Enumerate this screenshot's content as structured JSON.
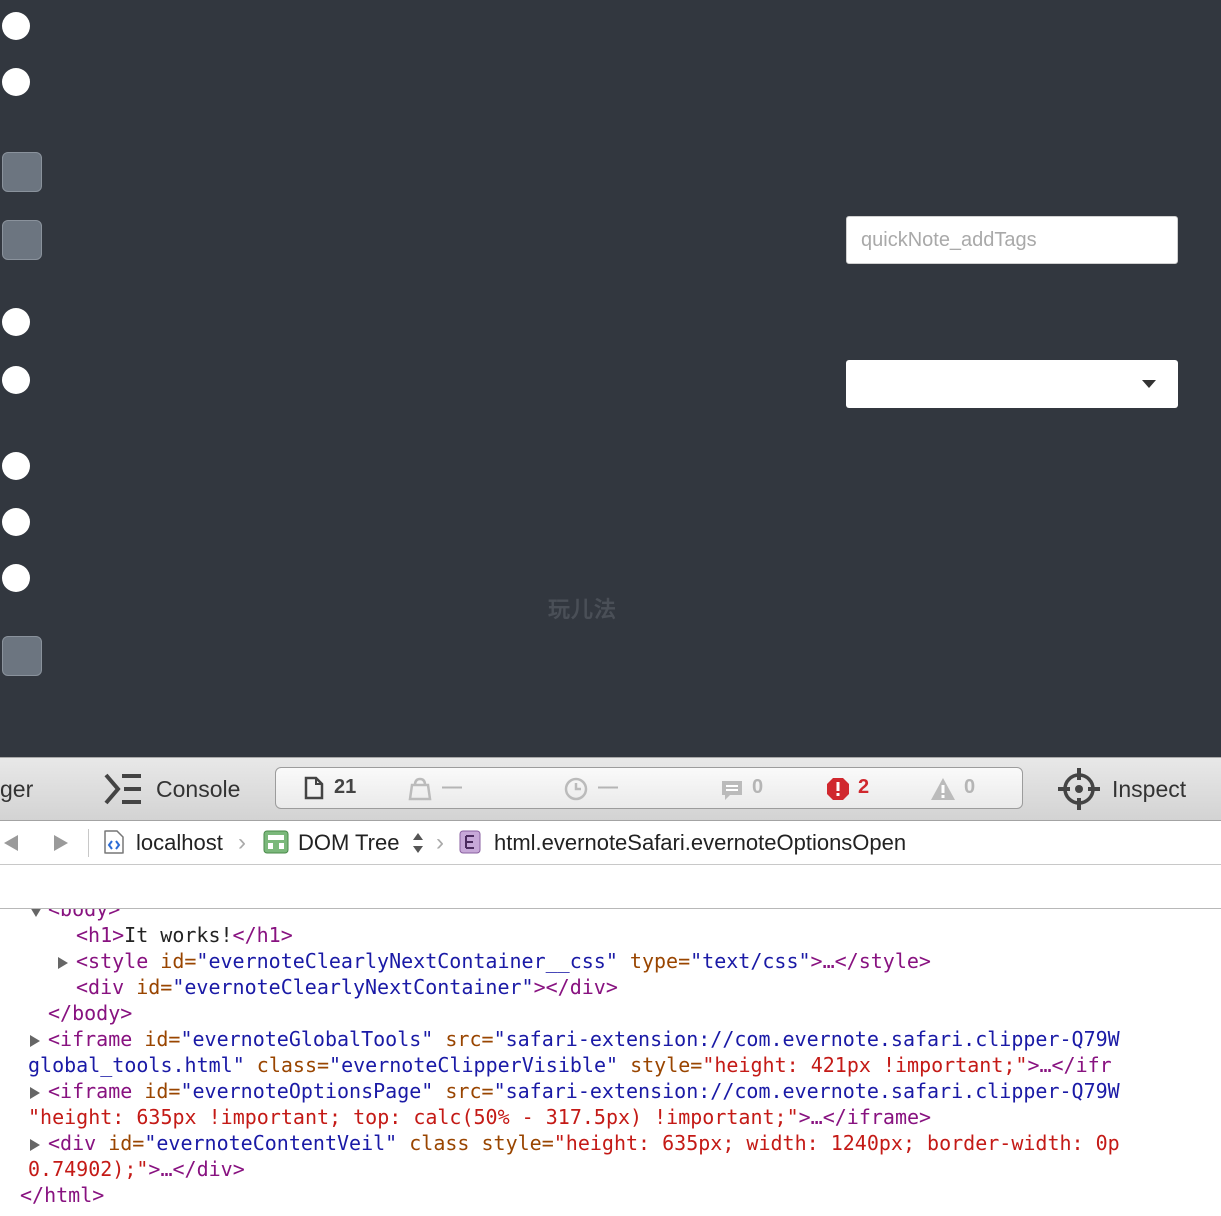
{
  "page": {
    "quicknote_placeholder": "quickNote_addTags",
    "watermark": "玩儿法"
  },
  "toolbar": {
    "partial_tab": "ger",
    "console_label": "Console",
    "resources_count": "21",
    "network_value": "—",
    "time_value": "—",
    "logs_count": "0",
    "errors_count": "2",
    "warnings_count": "0",
    "inspect_label": "Inspect"
  },
  "breadcrumb": {
    "host": "localhost",
    "view": "DOM Tree",
    "element": "html.evernoteSafari.evernoteOptionsOpen"
  },
  "dom": {
    "l0": "<body>",
    "h1_open": "<h1>",
    "h1_text": "It works!",
    "h1_close": "</h1>",
    "style_open": "<style",
    "style_id_attr": " id=",
    "style_id_val": "\"evernoteClearlyNextContainer__css\"",
    "style_type_attr": " type=",
    "style_type_val": "\"text/css\"",
    "style_rest": ">…</style>",
    "div_open": "<div",
    "div_id_attr": " id=",
    "div_id_val": "\"evernoteClearlyNextContainer\"",
    "div_close": "></div>",
    "body_close": "</body>",
    "if1_open": "<iframe",
    "if1_id_attr": " id=",
    "if1_id_val": "\"evernoteGlobalTools\"",
    "if1_src_attr": " src=",
    "if1_src_val": "\"safari-extension://com.evernote.safari.clipper-Q79W",
    "if1_l2_src": "global_tools.html\"",
    "if1_class_attr": " class=",
    "if1_class_val": "\"evernoteClipperVisible\"",
    "if1_style_attr": " style=",
    "if1_style_val": "\"height: 421px !important;\"",
    "if1_end": ">…</ifr",
    "if2_open": "<iframe",
    "if2_id_attr": " id=",
    "if2_id_val": "\"evernoteOptionsPage\"",
    "if2_src_attr": " src=",
    "if2_src_val": "\"safari-extension://com.evernote.safari.clipper-Q79W",
    "if2_l2_style": "\"height: 635px !important; top: calc(50% - 317.5px) !important;\"",
    "if2_end": ">…</iframe>",
    "div2_open": "<div",
    "div2_id_attr": " id=",
    "div2_id_val": "\"evernoteContentVeil\"",
    "div2_class_attr": " class",
    "div2_style_attr": " style=",
    "div2_style_val": "\"height: 635px; width: 1240px; border-width: 0p",
    "div2_l2_val": "0.74902);\"",
    "div2_end": ">…</div>",
    "html_close": "</html>"
  }
}
